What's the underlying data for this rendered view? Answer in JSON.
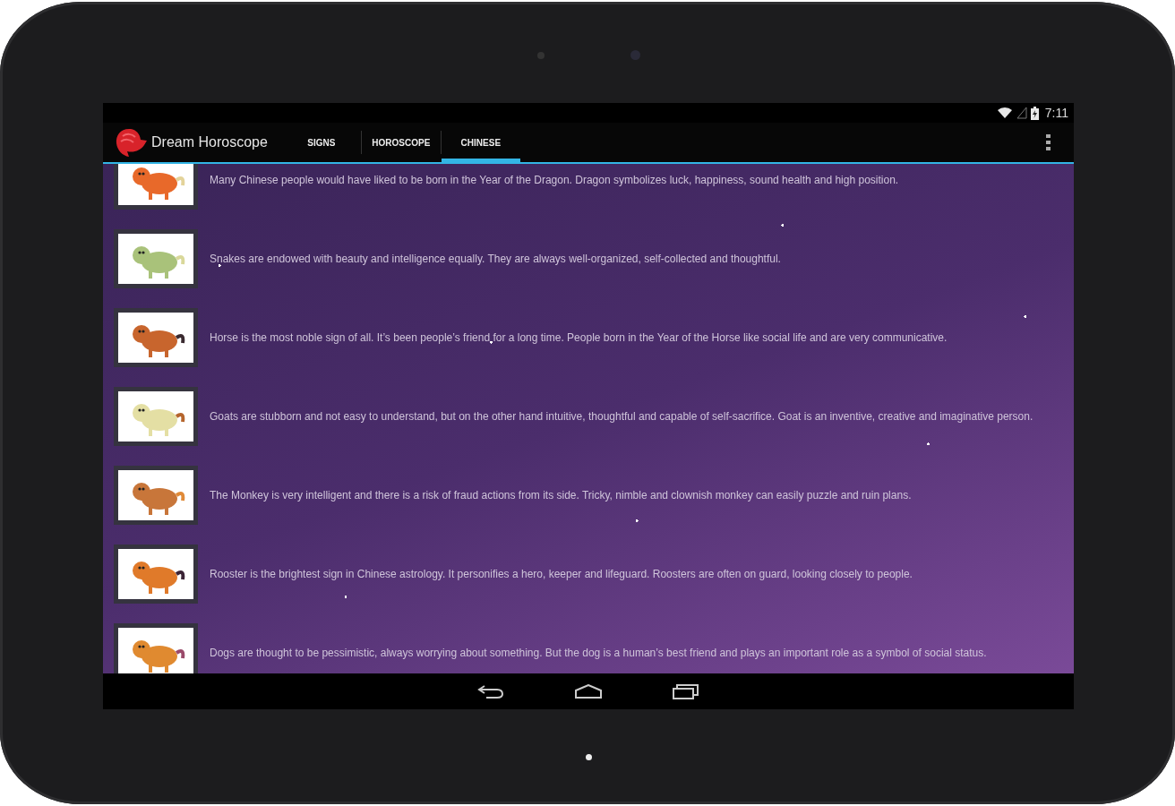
{
  "status_bar": {
    "time": "7:11"
  },
  "action_bar": {
    "title": "Dream Horoscope",
    "tabs": [
      {
        "label": "SIGNS",
        "selected": false
      },
      {
        "label": "HOROSCOPE",
        "selected": false
      },
      {
        "label": "CHINESE",
        "selected": true
      }
    ]
  },
  "signs": [
    {
      "kind": "dragon",
      "text": "Many Chinese people would have liked to be born in the Year of the Dragon. Dragon symbolizes luck, happiness, sound health and high position."
    },
    {
      "kind": "snake",
      "text": "Snakes are endowed with beauty and intelligence equally. They are always well-organized, self-collected and thoughtful."
    },
    {
      "kind": "horse",
      "text": "Horse is the most noble sign of all. It’s been people’s friend for a long time. People born in the Year of the Horse like social life and are very communicative."
    },
    {
      "kind": "goat",
      "text": "Goats are stubborn and not easy to understand, but on the other hand intuitive, thoughtful and capable of self-sacrifice. Goat is an inventive, creative and imaginative person."
    },
    {
      "kind": "monkey",
      "text": "The Monkey is very intelligent and there is a risk of fraud actions from its side. Tricky, nimble and clownish monkey can easily puzzle and ruin plans."
    },
    {
      "kind": "rooster",
      "text": "Rooster is the brightest sign in Chinese astrology. It personifies a hero, keeper and lifeguard. Roosters are often on guard, looking closely to people."
    },
    {
      "kind": "dog",
      "text": "Dogs are thought to be pessimistic, always worrying about something. But the dog is a human’s best friend and plays an important role as a symbol of social status."
    }
  ]
}
